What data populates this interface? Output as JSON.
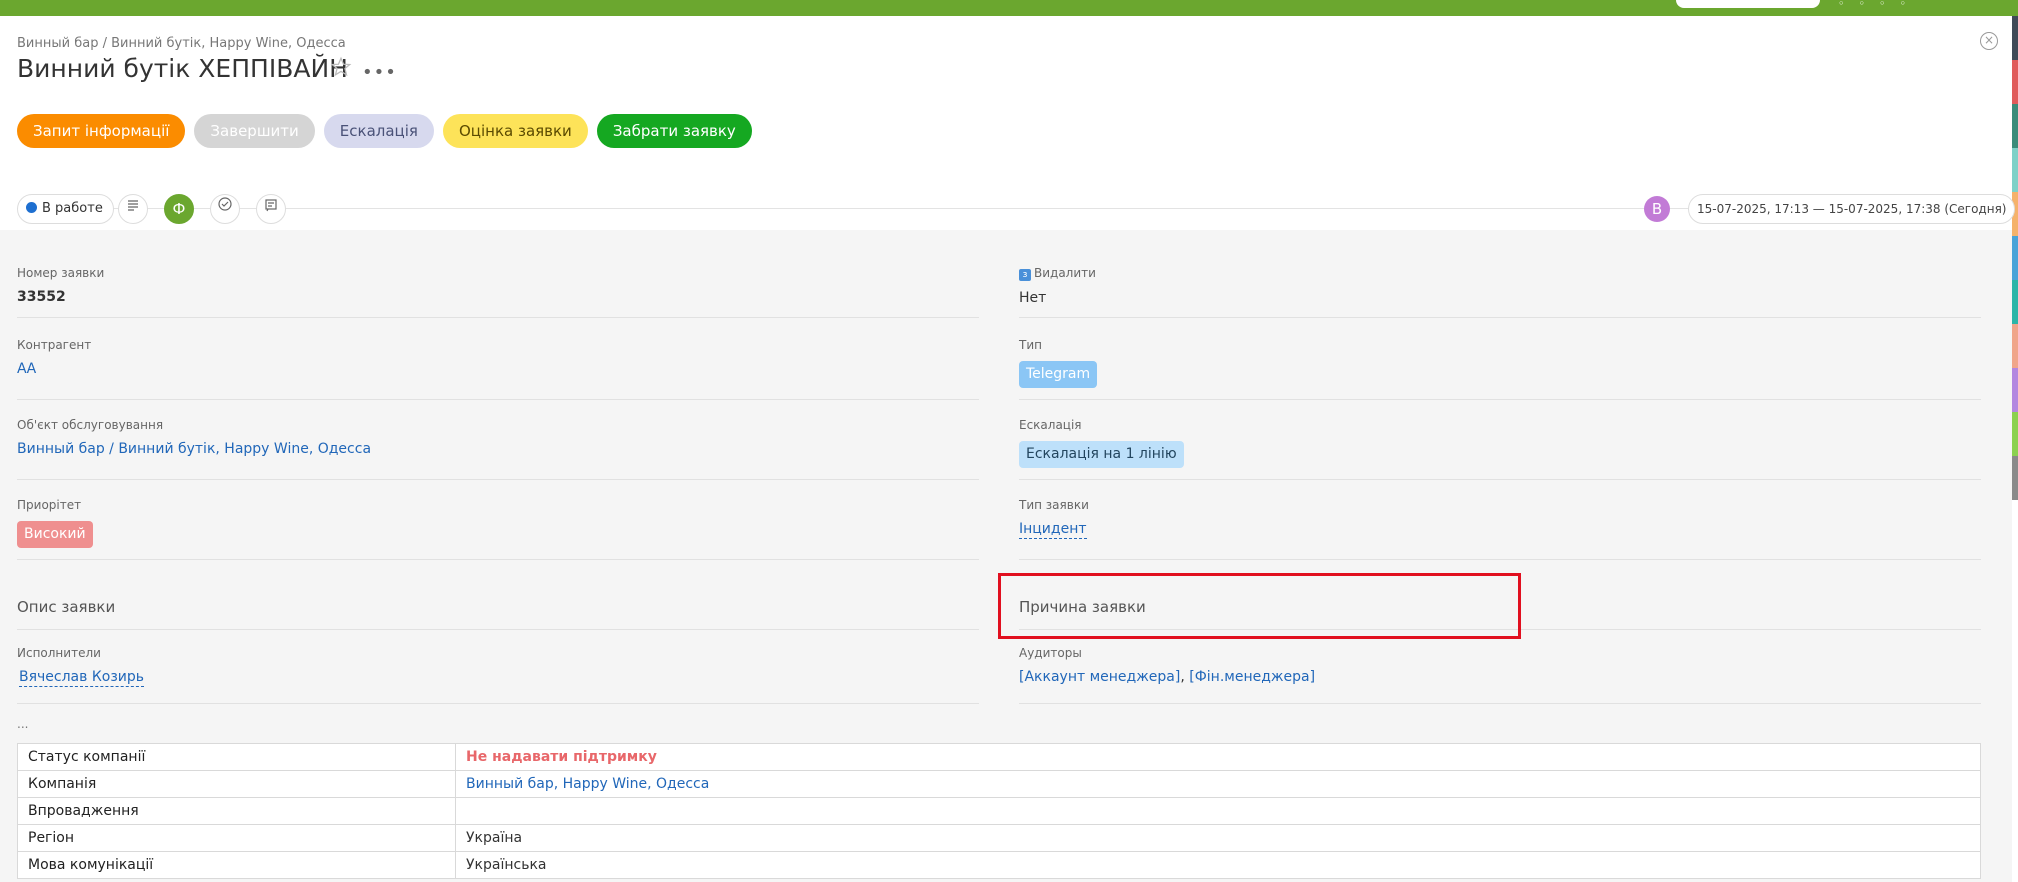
{
  "breadcrumb": "Винный бар / Винний бутік, Happy Wine, Одесса",
  "title": "Винний бутік ХЕППІВАЙН",
  "icons": {
    "favorite": "star-icon",
    "more": "more-icon",
    "close": "close-icon"
  },
  "actions": [
    {
      "label": "Запит інформації",
      "color": "#fb8c00"
    },
    {
      "label": "Завершити",
      "color": "#d5d5d5"
    },
    {
      "label": "Ескалація",
      "color": "#d7d9ee"
    },
    {
      "label": "Оцінка заявки",
      "color": "#fde359"
    },
    {
      "label": "Забрати заявку",
      "color": "#15a821"
    }
  ],
  "toolbar": {
    "status": "В работе",
    "status_color": "#1e6fd0",
    "tool_icons": [
      "list-icon",
      "form-icon",
      "checklist-icon",
      "comments-icon"
    ],
    "form_letter": "Ф",
    "avatar_letter": "В",
    "date_range": "15-07-2025, 17:13 — 15-07-2025, 17:38  (Сегодня)"
  },
  "fields": {
    "number": {
      "label": "Номер заявки",
      "value": "33552"
    },
    "delete": {
      "label": "Видалити",
      "value": "Нет"
    },
    "counterparty": {
      "label": "Контрагент",
      "value": "АА"
    },
    "type": {
      "label": "Тип",
      "value": "Telegram"
    },
    "object": {
      "label": "Об'єкт обслуговування",
      "value": "Винный бар / Винний бутік, Happy Wine, Одесса"
    },
    "escalation": {
      "label": "Ескалація",
      "value": "Ескалація на 1 лінію"
    },
    "priority": {
      "label": "Приорітет",
      "value": "Високий"
    },
    "request_type": {
      "label": "Тип заявки",
      "value": "Інцидент"
    },
    "description": {
      "label": "Опис заявки"
    },
    "reason": {
      "label": "Причина заявки"
    },
    "executors": {
      "label": "Исполнители",
      "value": "Вячеслав Козирь"
    },
    "auditors": {
      "label": "Аудиторы",
      "values": [
        "[Аккаунт менеджера]",
        "[Фін.менеджера]"
      ]
    }
  },
  "ellipsis": "...",
  "info_table": [
    {
      "key": "Статус компанії",
      "value": "Не надавати підтримку"
    },
    {
      "key": "Компанія",
      "value": "Винный бар, Happy Wine, Одесса"
    },
    {
      "key": "Впровадження",
      "value": ""
    },
    {
      "key": "Регіон",
      "value": "Україна"
    },
    {
      "key": "Мова комунікації",
      "value": "Українська"
    }
  ],
  "colors": {
    "accent_green": "#6ba72f",
    "highlight_red": "#e10f1f",
    "link": "#2167b9"
  }
}
